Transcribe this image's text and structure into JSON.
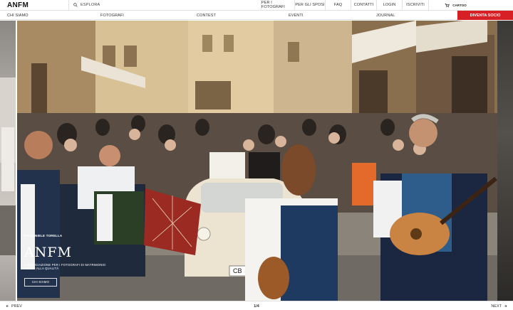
{
  "header": {
    "logo": "ANFM",
    "search": {
      "label": "ESPLORA",
      "icon": "search-icon"
    },
    "nav": [
      {
        "label": "PER I FOTOGRAFI"
      },
      {
        "label": "PER GLI SPOSI"
      },
      {
        "label": "FAQ"
      },
      {
        "label": "CONTATTI"
      },
      {
        "label": "LOGIN"
      },
      {
        "label": "ISCRIVITI"
      }
    ],
    "cart": {
      "label": "CARTOO",
      "icon": "cart-icon"
    }
  },
  "categories": {
    "items": [
      {
        "label": "CHI SIAMO"
      },
      {
        "label": "FOTOGRAFI"
      },
      {
        "label": "CONTEST"
      },
      {
        "label": "EVENTI"
      },
      {
        "label": "JOURNAL"
      }
    ],
    "cta": {
      "label": "DIVENTA SOCIO",
      "color": "#d71f26"
    }
  },
  "hero": {
    "credit": "PH DANIELE TORELLA",
    "brand": "ANFM",
    "tagline": "L'ASSOCIAZIONE PER I FOTOGRAFI DI MATRIMONIO ADATTI ALLA QUALITÀ",
    "button": "CHI SIAMO",
    "car_plate": "CB"
  },
  "footer": {
    "prev": "PREV",
    "pager": "1/4",
    "next": "NEXT"
  }
}
